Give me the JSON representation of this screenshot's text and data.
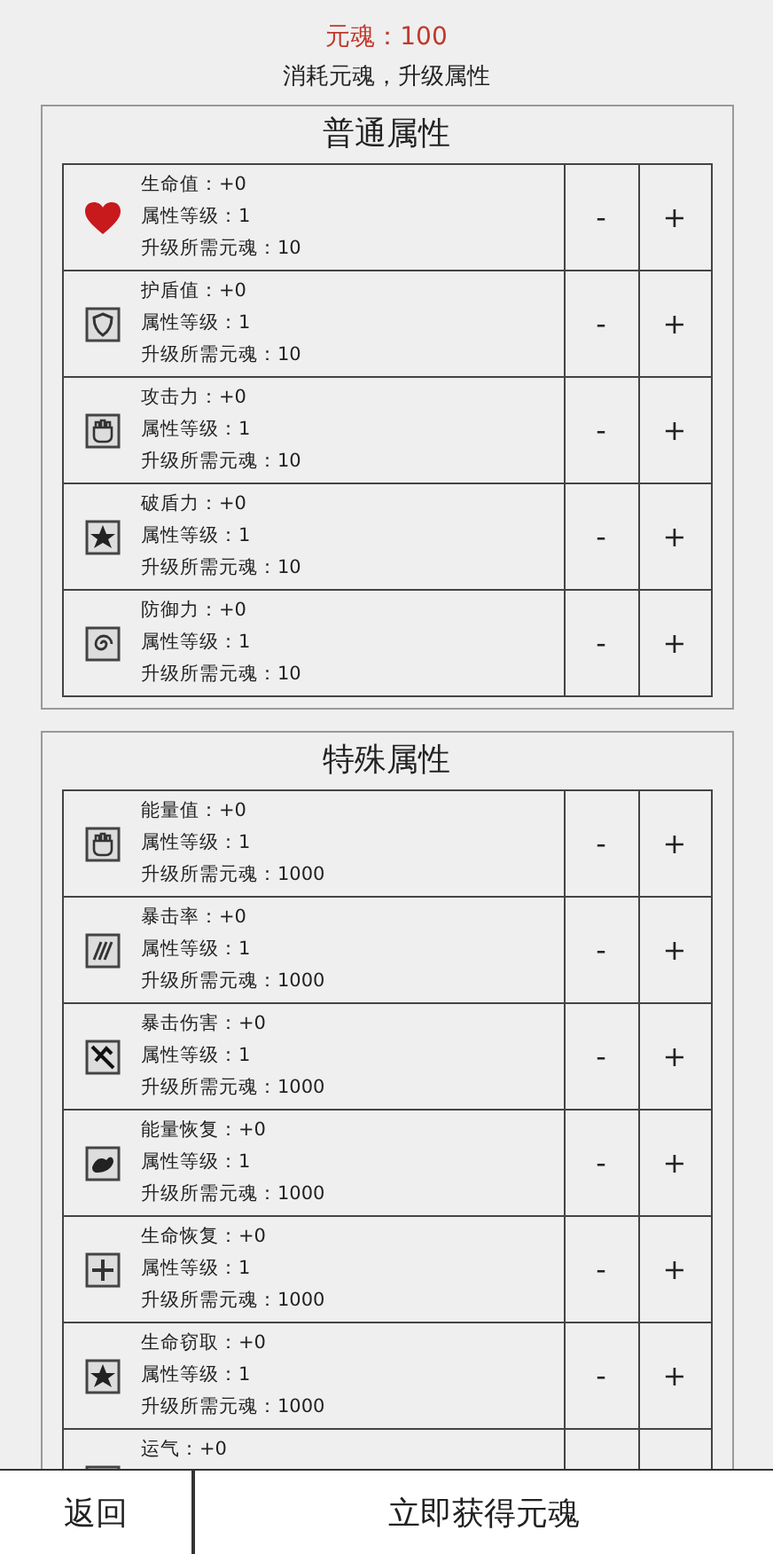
{
  "soul": "元魂：100",
  "subtitle": "消耗元魂，升级属性",
  "sections": [
    {
      "title": "普通属性",
      "rows": [
        {
          "name": "生命值：+0",
          "level": "属性等级：1",
          "cost": "升级所需元魂：10",
          "minus": "-",
          "plus": "+"
        },
        {
          "name": "护盾值：+0",
          "level": "属性等级：1",
          "cost": "升级所需元魂：10",
          "minus": "-",
          "plus": "+"
        },
        {
          "name": "攻击力：+0",
          "level": "属性等级：1",
          "cost": "升级所需元魂：10",
          "minus": "-",
          "plus": "+"
        },
        {
          "name": "破盾力：+0",
          "level": "属性等级：1",
          "cost": "升级所需元魂：10",
          "minus": "-",
          "plus": "+"
        },
        {
          "name": "防御力：+0",
          "level": "属性等级：1",
          "cost": "升级所需元魂：10",
          "minus": "-",
          "plus": "+"
        }
      ]
    },
    {
      "title": "特殊属性",
      "rows": [
        {
          "name": "能量值：+0",
          "level": "属性等级：1",
          "cost": "升级所需元魂：1000",
          "minus": "-",
          "plus": "+"
        },
        {
          "name": "暴击率：+0",
          "level": "属性等级：1",
          "cost": "升级所需元魂：1000",
          "minus": "-",
          "plus": "+"
        },
        {
          "name": "暴击伤害：+0",
          "level": "属性等级：1",
          "cost": "升级所需元魂：1000",
          "minus": "-",
          "plus": "+"
        },
        {
          "name": "能量恢复：+0",
          "level": "属性等级：1",
          "cost": "升级所需元魂：1000",
          "minus": "-",
          "plus": "+"
        },
        {
          "name": "生命恢复：+0",
          "level": "属性等级：1",
          "cost": "升级所需元魂：1000",
          "minus": "-",
          "plus": "+"
        },
        {
          "name": "生命窃取：+0",
          "level": "属性等级：1",
          "cost": "升级所需元魂：1000",
          "minus": "-",
          "plus": "+"
        },
        {
          "name": "运气：+0"
        }
      ]
    }
  ],
  "buttons": [
    "返回",
    "立即获得元魂"
  ]
}
